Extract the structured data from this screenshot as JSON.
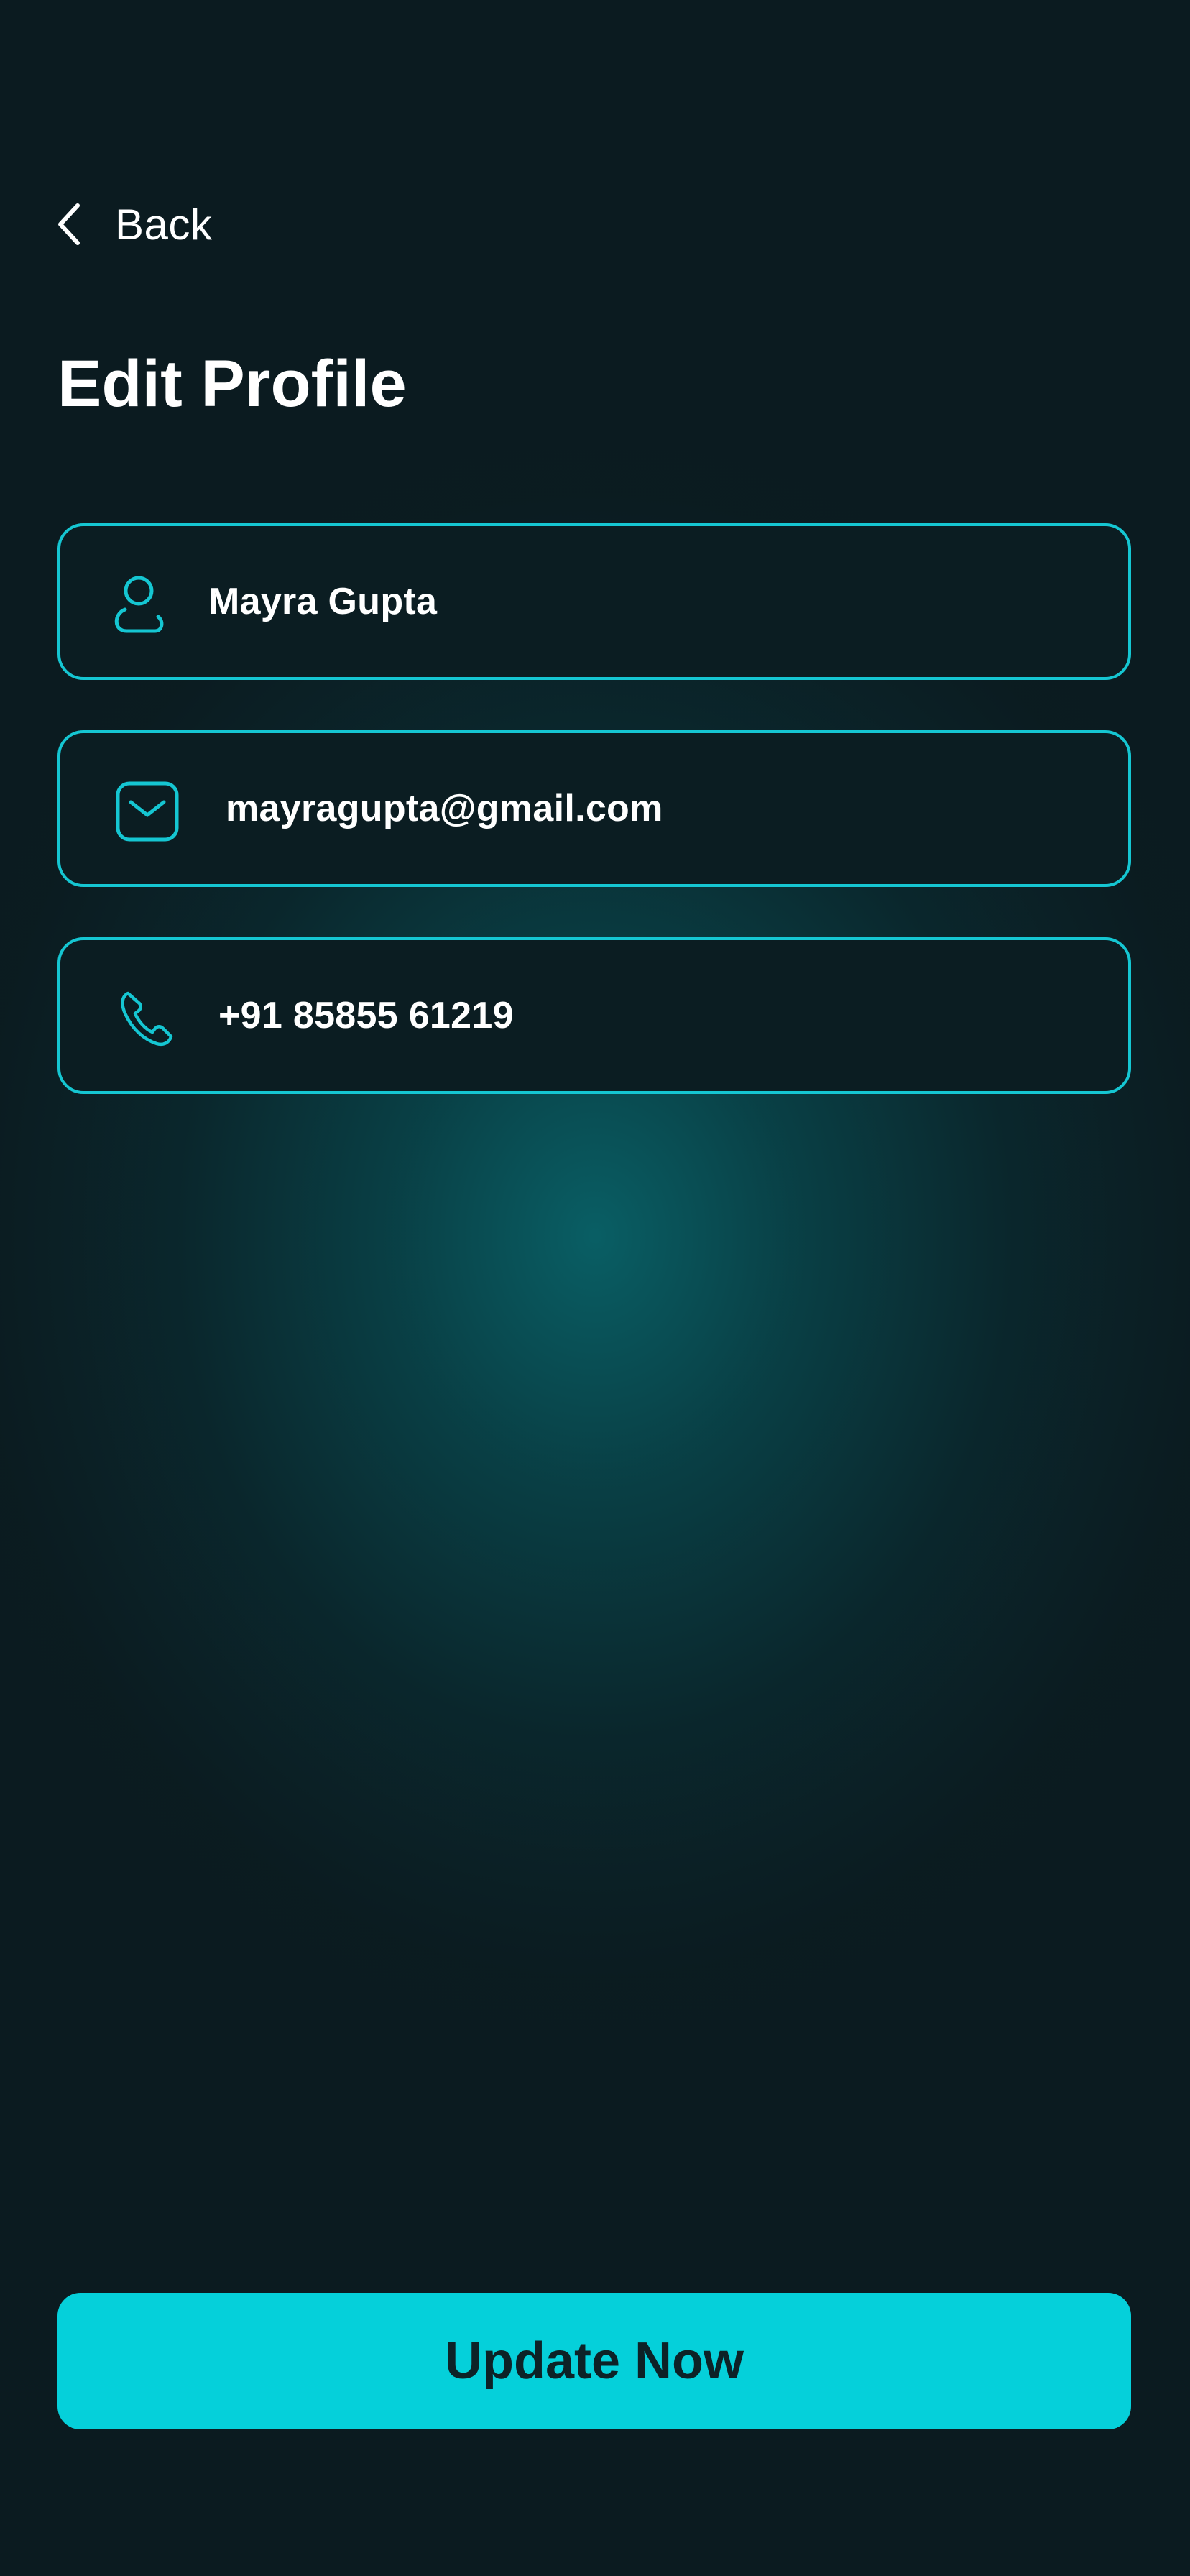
{
  "header": {
    "back_label": "Back",
    "title": "Edit Profile"
  },
  "form": {
    "name": {
      "value": "Mayra Gupta",
      "icon": "user-icon"
    },
    "email": {
      "value": "mayragupta@gmail.com",
      "icon": "mail-icon"
    },
    "phone": {
      "value": "+91 85855 61219",
      "icon": "phone-icon"
    }
  },
  "actions": {
    "update_label": "Update Now"
  },
  "colors": {
    "accent": "#05d0da",
    "field_border": "#15c6d2",
    "background": "#0b1b20",
    "glow": "#096268"
  }
}
